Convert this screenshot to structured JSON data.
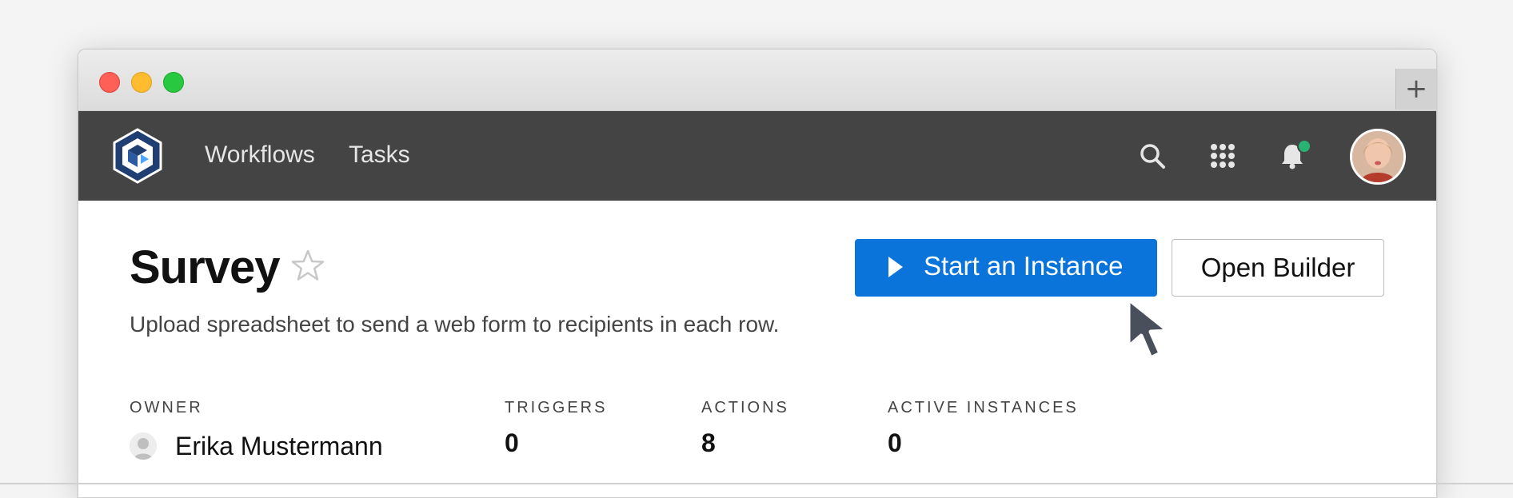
{
  "nav": {
    "links": [
      "Workflows",
      "Tasks"
    ],
    "icons": [
      "search-icon",
      "apps-grid-icon",
      "bell-icon"
    ],
    "notification_dot_color": "#27b372",
    "new_tab_symbol": "+"
  },
  "page": {
    "title": "Survey",
    "description": "Upload spreadsheet to send a web form to recipients in each row.",
    "primary_button": "Start an Instance",
    "secondary_button": "Open Builder",
    "accent_color": "#0a74da"
  },
  "stats": {
    "owner_label": "OWNER",
    "owner_name": "Erika Mustermann",
    "triggers_label": "TRIGGERS",
    "triggers_value": "0",
    "actions_label": "ACTIONS",
    "actions_value": "8",
    "active_instances_label": "ACTIVE INSTANCES",
    "active_instances_value": "0"
  }
}
